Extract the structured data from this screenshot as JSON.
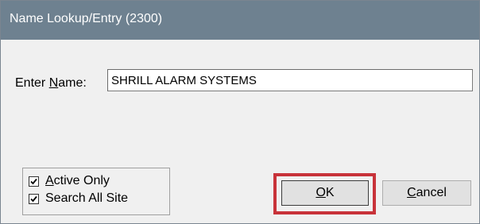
{
  "window": {
    "title": "Name Lookup/Entry (2300)",
    "colors": {
      "titlebar": "#6e8190",
      "highlight": "#c8333a",
      "dialog_bg": "#f0f0f0"
    }
  },
  "name_field": {
    "label_mnemonic_prefix": "Enter ",
    "label_mnemonic_char": "N",
    "label_mnemonic_suffix": "ame:",
    "value": "SHRILL ALARM SYSTEMS"
  },
  "options": {
    "active_only": {
      "label_mnemonic_char": "A",
      "label_rest": "ctive Only",
      "checked": true
    },
    "search_all_site": {
      "label": "Search All Site",
      "checked": true
    }
  },
  "buttons": {
    "ok": {
      "mnemonic_char": "O",
      "rest": "K",
      "highlighted": true
    },
    "cancel": {
      "mnemonic_char": "C",
      "rest": "ancel"
    }
  },
  "icons": {
    "checkbox_check": "checkmark-icon"
  }
}
